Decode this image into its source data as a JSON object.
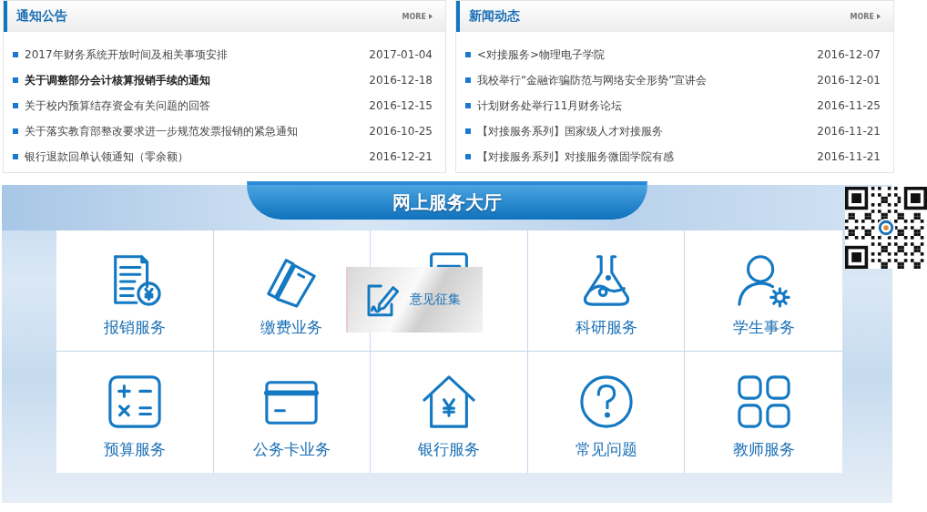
{
  "panels": [
    {
      "title": "通知公告",
      "more": "MORE",
      "items": [
        {
          "text": "2017年财务系统开放时间及相关事项安排",
          "date": "2017-01-04",
          "emphasized": false
        },
        {
          "text": "关于调整部分会计核算报销手续的通知",
          "date": "2016-12-18",
          "emphasized": true
        },
        {
          "text": "关于校内预算结存资金有关问题的回答",
          "date": "2016-12-15",
          "emphasized": false
        },
        {
          "text": "关于落实教育部整改要求进一步规范发票报销的紧急通知",
          "date": "2016-10-25",
          "emphasized": false
        },
        {
          "text": "银行退款回单认领通知（零余额）",
          "date": "2016-12-21",
          "emphasized": false
        }
      ]
    },
    {
      "title": "新闻动态",
      "more": "MORE",
      "items": [
        {
          "text": "<对接服务>物理电子学院",
          "date": "2016-12-07",
          "emphasized": false
        },
        {
          "text": "我校举行“金融诈骗防范与网络安全形势”宣讲会",
          "date": "2016-12-01",
          "emphasized": false
        },
        {
          "text": "计划财务处举行11月财务论坛",
          "date": "2016-11-25",
          "emphasized": false
        },
        {
          "text": "【对接服务系列】国家级人才对接服务",
          "date": "2016-11-21",
          "emphasized": false
        },
        {
          "text": "【对接服务系列】对接服务微固学院有感",
          "date": "2016-11-21",
          "emphasized": false
        }
      ]
    }
  ],
  "service_hall": {
    "title": "网上服务大厅",
    "tiles": [
      {
        "kind": "receipt",
        "label": "报销服务"
      },
      {
        "kind": "bills",
        "label": "缴费业务"
      },
      {
        "kind": "document"
      },
      {
        "kind": "flask",
        "label": "科研服务"
      },
      {
        "kind": "user",
        "label": "学生事务"
      },
      {
        "kind": "calculator",
        "label": "预算服务"
      },
      {
        "kind": "card",
        "label": "公务卡业务"
      },
      {
        "kind": "bank",
        "label": "银行服务"
      },
      {
        "kind": "question",
        "label": "常见问题"
      },
      {
        "kind": "apps",
        "label": "教师服务"
      }
    ],
    "feedback": {
      "label": "意见征集"
    }
  }
}
